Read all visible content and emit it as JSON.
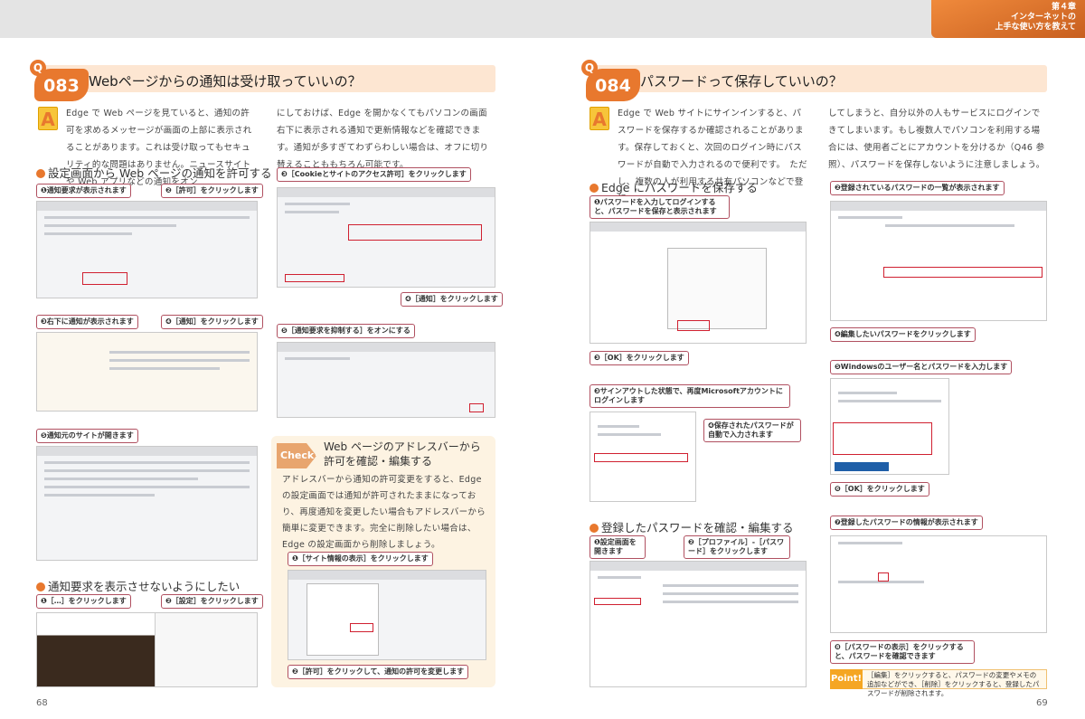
{
  "chapter": {
    "number": "第４章",
    "title_line1": "インターネットの",
    "title_line2": "上手な使い方を教えて"
  },
  "left": {
    "q_letter": "Q",
    "q_number": "083",
    "q_title": "Webページからの通知は受け取っていいの？",
    "a_letter": "A",
    "answer_col1": "Edge で Web ページを見ていると、通知の許可を求めるメッセージが画面の上部に表示されることがあります。これは受け取ってもセキュリティ的な問題はありません。ニュースサイトや Web アプリなどの通知をオン",
    "answer_col2": "にしておけば、Edge を開かなくてもパソコンの画面右下に表示される通知で更新情報などを確認できます。通知が多すぎてわずらわしい場合は、オフに切り替えることももちろん可能です。",
    "section1": "設定画面から Web ページの通知を許可する",
    "section2": "通知要求を表示させないようにしたい",
    "steps": [
      "❶通知要求が表示されます",
      "❷［許可］をクリックします",
      "❸右下に通知が表示されます",
      "❹［通知］をクリックします",
      "❺通知元のサイトが開きます"
    ],
    "steps2": [
      "❶［…］をクリックします",
      "❷［設定］をクリックします",
      "❸［Cookieとサイトのアクセス許可］をクリックします",
      "❹［通知］をクリックします",
      "❺［通知要求を抑制する］をオンにする"
    ],
    "check": {
      "tag": "Check!",
      "title_line1": "Web ページのアドレスバーから",
      "title_line2": "許可を確認・編集する",
      "body": "アドレスバーから通知の許可変更をすると、Edge の設定画面では通知が許可されたままになっており、再度通知を変更したい場合もアドレスバーから簡単に変更できます。完全に削除したい場合は、Edge の設定画面から削除しましょう。",
      "step1": "❶［サイト情報の表示］をクリックします",
      "step2": "❷［許可］をクリックして、通知の許可を変更します"
    },
    "page_number": "68"
  },
  "right": {
    "q_letter": "Q",
    "q_number": "084",
    "q_title": "パスワードって保存していいの？",
    "a_letter": "A",
    "answer_col1": "Edge で Web サイトにサインインすると、パスワードを保存するか確認されることがあります。保存しておくと、次回のログイン時にパスワードが自動で入力されるので便利です。　ただし、複数の人が利用する共有パソコンなどで登録",
    "answer_col2": "してしまうと、自分以外の人もサービスにログインできてしまいます。もし複数人でパソコンを利用する場合には、使用者ごとにアカウントを分けるか（Q46 参照）、パスワードを保存しないように注意しましょう。",
    "section1": "Edge にパスワードを保存する",
    "section2": "登録したパスワードを確認・編集する",
    "steps": [
      "❶パスワードを入力してログインすると、パスワードを保存と表示されます",
      "❷登録されているパスワードの一覧が表示されます",
      "❸［OK］をクリックします",
      "❹編集したいパスワードをクリックします",
      "❺Windowsのユーザー名とパスワードを入力します",
      "❸サインアウトした状態で、再度Microsoftアカウントにログインします",
      "❹保存されたパスワードが自動で入力されます",
      "❻［OK］をクリックします"
    ],
    "steps2": [
      "❶設定画面を開きます",
      "❷［プロファイル］-［パスワード］をクリックします",
      "❼登録したパスワードの情報が表示されます",
      "❽［パスワードの表示］をクリックすると、パスワードを確認できます"
    ],
    "point": {
      "tag": "Point!",
      "text": "［編集］をクリックすると、パスワードの変更やメモの追加などができ、［削除］をクリックすると、登録したパスワードが削除されます。"
    },
    "page_number": "69"
  },
  "colors": {
    "accent": "#e8782e",
    "callout_border": "#d02030"
  }
}
